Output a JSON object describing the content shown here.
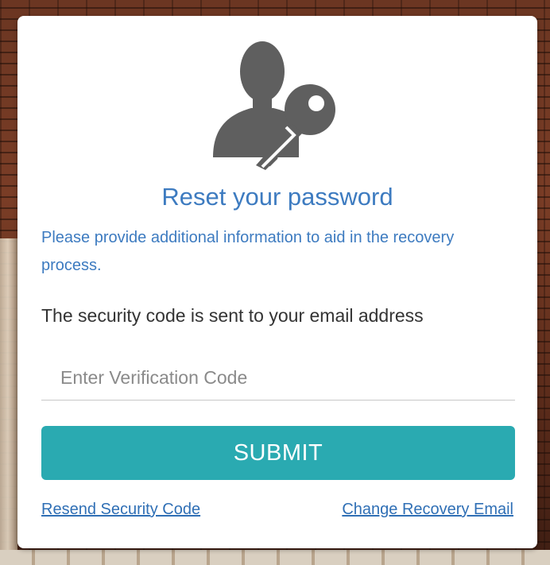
{
  "reset": {
    "title": "Reset your password",
    "subtitle": "Please provide additional information to aid in the recovery process.",
    "info": "The security code is sent to your email address",
    "code_placeholder": "Enter Verification Code",
    "submit_label": "SUBMIT",
    "resend_link": "Resend Security Code",
    "change_email_link": "Change Recovery Email",
    "icon": "user-key-icon"
  },
  "colors": {
    "accent": "#3d7bc0",
    "button": "#2aaab1",
    "link": "#2f6fb5",
    "icon": "#5f5f5f"
  }
}
